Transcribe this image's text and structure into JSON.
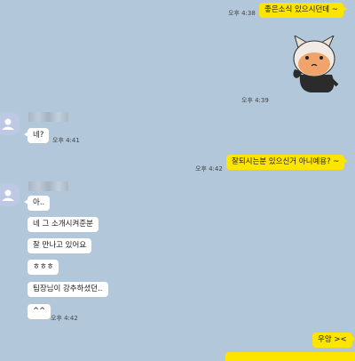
{
  "messages": {
    "m1": {
      "text": "좋은소식 있으시던데 ~",
      "time": "오후 4:38"
    },
    "sticker": {
      "time": "오후 4:39"
    },
    "m2": {
      "text": "네?",
      "time": "오후 4:41"
    },
    "m3": {
      "text": "잘되시는분 있으신거 아니예용? ~",
      "time": "오후 4:42"
    },
    "m4": {
      "text": "아.."
    },
    "m5": {
      "text": "네 그 소개시켜준분"
    },
    "m6": {
      "text": "잘 만나고 있어요"
    },
    "m7": {
      "text": "ㅎㅎㅎ"
    },
    "m8": {
      "text": "팀장님이 강추하셨던.."
    },
    "m9": {
      "text": "^^",
      "time": "오후 4:42"
    },
    "m10": {
      "text": "우앙 ><"
    }
  },
  "colors": {
    "background": "#b2c7da",
    "my_bubble": "#fee500",
    "their_bubble": "#ffffff"
  }
}
